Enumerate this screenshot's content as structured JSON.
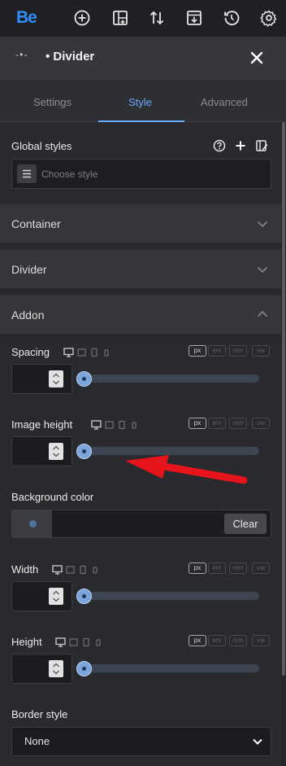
{
  "toolbar": {
    "logo": "Be",
    "icons": [
      "add-circle-icon",
      "layout-grid-add-icon",
      "sort-arrows-icon",
      "download-layout-icon",
      "history-icon",
      "gear-icon"
    ]
  },
  "element": {
    "glyph": "-•- ",
    "title": "• Divider"
  },
  "tabs": [
    "Settings",
    "Style",
    "Advanced"
  ],
  "active_tab": "Style",
  "global_styles": {
    "label": "Global styles",
    "placeholder": "Choose style"
  },
  "sections": [
    {
      "label": "Container",
      "expanded": false
    },
    {
      "label": "Divider",
      "expanded": false
    },
    {
      "label": "Addon",
      "expanded": true
    }
  ],
  "units": [
    "px",
    "em",
    "rem",
    "vw"
  ],
  "active_unit": "px",
  "fields": {
    "spacing": {
      "label": "Spacing",
      "value": "",
      "slider": 0
    },
    "image_height": {
      "label": "Image height",
      "value": "",
      "slider": 0
    },
    "width": {
      "label": "Width",
      "value": "",
      "slider": 0
    },
    "height": {
      "label": "Height",
      "value": "",
      "slider": 0
    }
  },
  "background_color": {
    "label": "Background color",
    "clear_label": "Clear"
  },
  "border_style": {
    "label": "Border style",
    "value": "None"
  },
  "colors": {
    "accent": "#6ea8ff",
    "logo": "#2f8fff",
    "annotation": "#e8141b"
  }
}
